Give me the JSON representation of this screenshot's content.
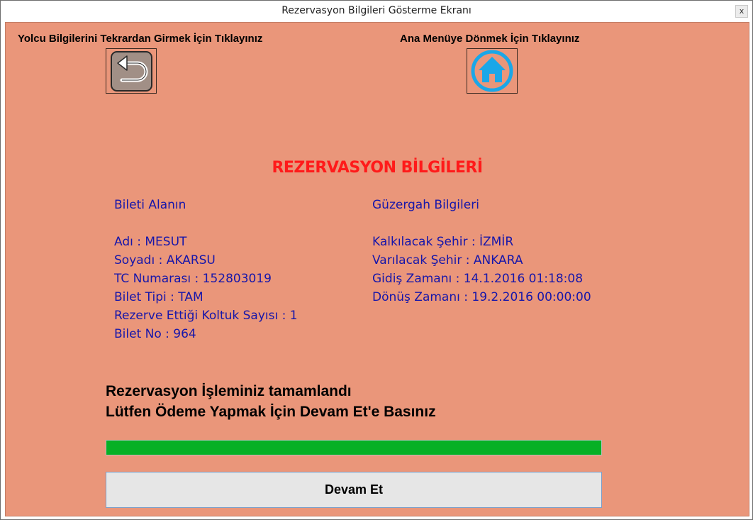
{
  "window": {
    "title": "Rezervasyon Bilgileri Gösterme Ekranı",
    "close_glyph": "x"
  },
  "top": {
    "back_label": "Yolcu Bilgilerini Tekrardan Girmek İçin Tıklayınız",
    "home_label": "Ana Menüye Dönmek İçin Tıklayınız",
    "back_icon": "back-arrow-icon",
    "home_icon": "home-icon"
  },
  "heading": "REZERVASYON BİLGİLERİ",
  "passenger": {
    "section_title": "Bileti Alanın",
    "lines": [
      "Adı : MESUT",
      "Soyadı : AKARSU",
      "TC Numarası : 152803019",
      "Bilet Tipi : TAM",
      "Rezerve Ettiği Koltuk Sayısı : 1",
      "Bilet No : 964"
    ]
  },
  "route": {
    "section_title": "Güzergah Bilgileri",
    "lines": [
      "Kalkılacak Şehir : İZMİR",
      "Varılacak Şehir : ANKARA",
      "Gidiş Zamanı : 14.1.2016 01:18:08",
      "Dönüş Zamanı : 19.2.2016 00:00:00"
    ]
  },
  "message": {
    "line1": "Rezervasyon İşleminiz tamamlandı",
    "line2": "Lütfen Ödeme Yapmak İçin Devam Et'e Basınız"
  },
  "progress": {
    "value_percent": 100
  },
  "continue_button": "Devam Et",
  "colors": {
    "background": "#ea967a",
    "heading": "#ff1a1a",
    "info_text": "#1616aa",
    "progress": "#06b025",
    "home_icon": "#1aa7e8"
  }
}
